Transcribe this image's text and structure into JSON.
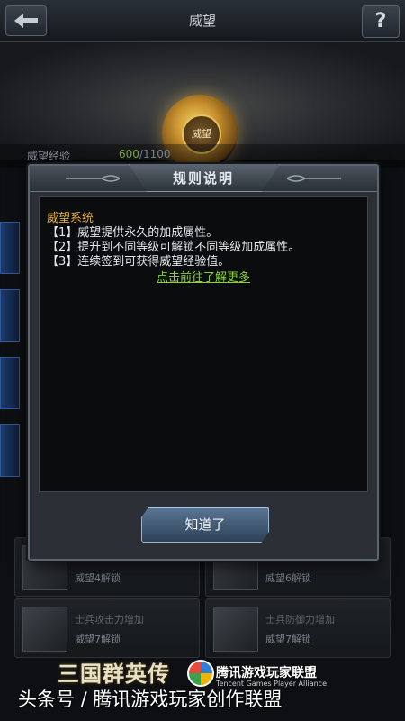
{
  "screen": {
    "title": "威望",
    "help_label": "?",
    "emblem_label": "威望",
    "xp": {
      "label": "威望经验",
      "current": "600",
      "max": "/1100"
    }
  },
  "background_cards": [
    {
      "title": "",
      "status": ""
    },
    {
      "title": "",
      "status": ""
    },
    {
      "title": "",
      "status": ""
    },
    {
      "title": "",
      "status": ""
    },
    {
      "title": "",
      "status": "威望4解锁"
    },
    {
      "title": "",
      "status": "威望6解锁"
    },
    {
      "title": "士兵攻击力增加",
      "status": "威望7解锁"
    },
    {
      "title": "士兵防御力增加",
      "status": "威望7解锁"
    }
  ],
  "dialog": {
    "title": "规则说明",
    "heading": "威望系统",
    "rules": [
      "【1】威望提供永久的加成属性。",
      "【2】提升到不同等级可解锁不同等级加成属性。",
      "【3】连续签到可获得威望经验值。"
    ],
    "link_label": "点击前往了解更多",
    "ok_label": "知道了"
  },
  "watermark": {
    "game_logo": "三国群英传",
    "alliance": "腾讯游戏玩家联盟",
    "alliance_sub": "Tencent Games Player Alliance",
    "footer": "头条号 / 腾讯游戏玩家创作联盟"
  },
  "colors": {
    "accent_gold": "#e0ad3f",
    "link_green": "#8ad13c",
    "xp_green": "#79b03a",
    "button_blue": "#4a6584"
  }
}
